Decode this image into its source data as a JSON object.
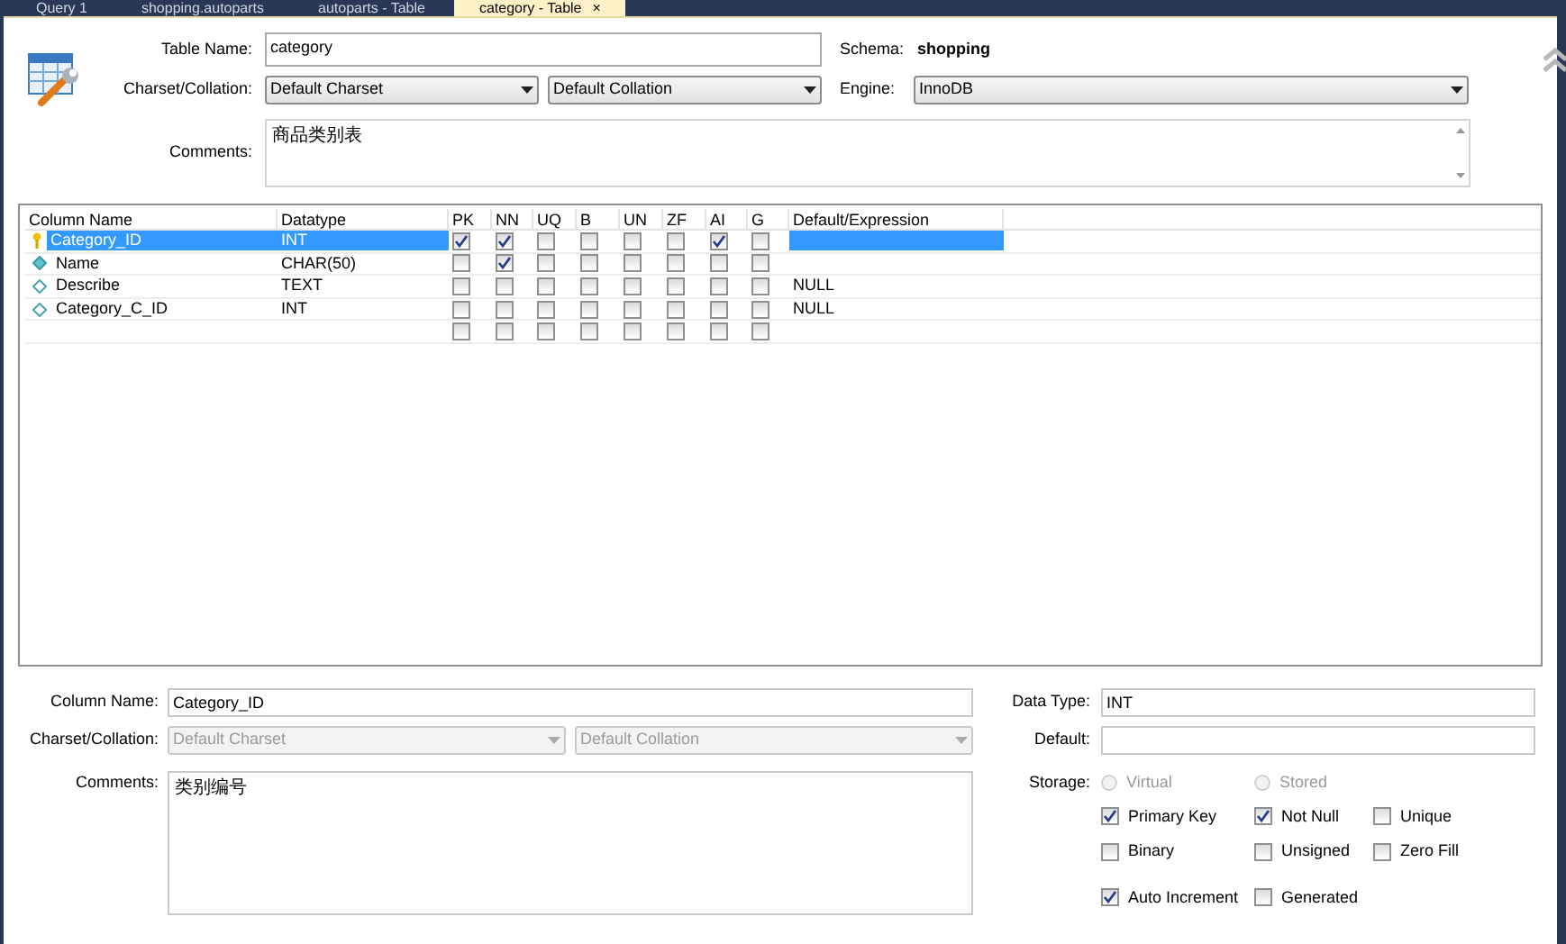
{
  "tabs": [
    {
      "label": "Query 1",
      "selected": false
    },
    {
      "label": "shopping.autoparts",
      "selected": false
    },
    {
      "label": "autoparts - Table",
      "selected": false
    },
    {
      "label": "category - Table",
      "selected": true
    }
  ],
  "tab_close": "×",
  "header": {
    "table_name_label": "Table Name:",
    "table_name": "category",
    "schema_label": "Schema:",
    "schema": "shopping",
    "charset_label": "Charset/Collation:",
    "charset": "Default Charset",
    "collation": "Default Collation",
    "engine_label": "Engine:",
    "engine": "InnoDB",
    "comments_label": "Comments:",
    "comments": "商品类别表"
  },
  "grid": {
    "columns": [
      "Column Name",
      "Datatype",
      "PK",
      "NN",
      "UQ",
      "B",
      "UN",
      "ZF",
      "AI",
      "G",
      "Default/Expression"
    ],
    "rows": [
      {
        "kind": "primary",
        "name": "Category_ID",
        "datatype": "INT",
        "flags": [
          true,
          true,
          false,
          false,
          false,
          false,
          true,
          false
        ],
        "default": "",
        "selected": true
      },
      {
        "kind": "notnull",
        "name": "Name",
        "datatype": "CHAR(50)",
        "flags": [
          false,
          true,
          false,
          false,
          false,
          false,
          false,
          false
        ],
        "default": "",
        "selected": false
      },
      {
        "kind": "nullable",
        "name": "Describe",
        "datatype": "TEXT",
        "flags": [
          false,
          false,
          false,
          false,
          false,
          false,
          false,
          false
        ],
        "default": "NULL",
        "selected": false
      },
      {
        "kind": "nullable",
        "name": "Category_C_ID",
        "datatype": "INT",
        "flags": [
          false,
          false,
          false,
          false,
          false,
          false,
          false,
          false
        ],
        "default": "NULL",
        "selected": false
      },
      {
        "kind": "new",
        "name": "",
        "datatype": "",
        "flags": [
          false,
          false,
          false,
          false,
          false,
          false,
          false,
          false
        ],
        "default": "",
        "selected": false
      }
    ]
  },
  "details": {
    "column_name_label": "Column Name:",
    "column_name": "Category_ID",
    "charset_label": "Charset/Collation:",
    "charset": "Default Charset",
    "collation": "Default Collation",
    "disabled": true,
    "comments_label": "Comments:",
    "comments": "类别编号",
    "data_type_label": "Data Type:",
    "data_type": "INT",
    "default_label": "Default:",
    "storage_label": "Storage:",
    "storage": [
      {
        "label": "Virtual",
        "selected": false,
        "disabled": true
      },
      {
        "label": "Stored",
        "selected": false,
        "disabled": true
      }
    ],
    "options": [
      {
        "label": "Primary Key",
        "checked": true
      },
      {
        "label": "Not Null",
        "checked": true
      },
      {
        "label": "Unique",
        "checked": false
      },
      {
        "label": "Binary",
        "checked": false
      },
      {
        "label": "Unsigned",
        "checked": false
      },
      {
        "label": "Zero Fill",
        "checked": false
      },
      {
        "label": "Auto Increment",
        "checked": true
      },
      {
        "label": "Generated",
        "checked": false
      }
    ]
  }
}
